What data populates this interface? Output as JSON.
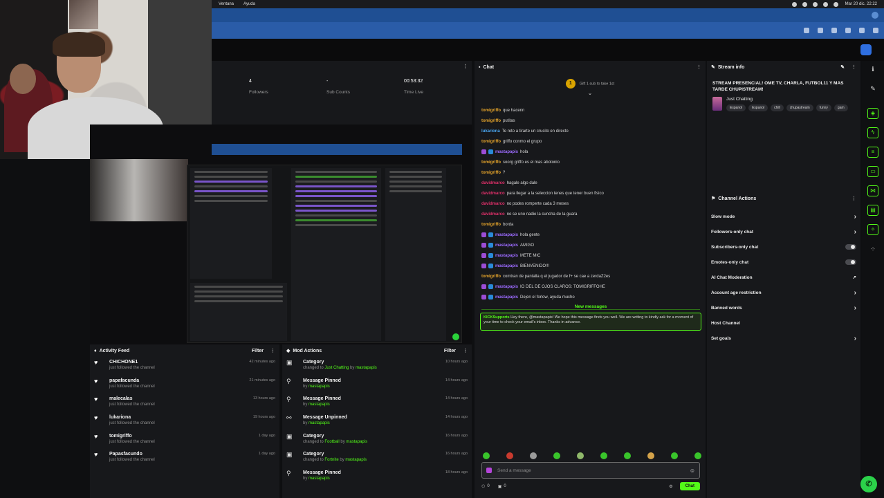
{
  "os_menu": {
    "items": [
      "Ventana",
      "Ayuda"
    ],
    "clock": "Mar 20 dic. 22:22"
  },
  "stats": [
    {
      "value": "4",
      "label": "Followers"
    },
    {
      "value": "-",
      "label": "Sub Counts"
    },
    {
      "value": "00:53:32",
      "label": "Time Live"
    }
  ],
  "activity": {
    "title": "Activity Feed",
    "filter": "Filter",
    "items": [
      {
        "name": "CHICHONE1",
        "sub": "just followed the channel",
        "time": "42 minutes ago"
      },
      {
        "name": "papafacunda",
        "sub": "just followed the channel",
        "time": "21 minutes ago"
      },
      {
        "name": "malecalas",
        "sub": "just followed the channel",
        "time": "13 hours ago"
      },
      {
        "name": "lukariona",
        "sub": "just followed the channel",
        "time": "19 hours ago"
      },
      {
        "name": "tomigriffo",
        "sub": "just followed the channel",
        "time": "1 day ago"
      },
      {
        "name": "Papasfacundo",
        "sub": "just followed the channel",
        "time": "1 day ago"
      }
    ]
  },
  "mod_actions": {
    "title": "Mod Actions",
    "filter": "Filter",
    "items": [
      {
        "icon": "category",
        "name": "Category",
        "pre": "changed to ",
        "hl": "Just Chatting",
        "post": " by ",
        "by": "mastapapis",
        "time": "10 hours ago"
      },
      {
        "icon": "pin",
        "name": "Message Pinned",
        "pre": "by ",
        "hl": "",
        "post": "",
        "by": "mastapapis",
        "time": "14 hours ago"
      },
      {
        "icon": "pin",
        "name": "Message Pinned",
        "pre": "by ",
        "hl": "",
        "post": "",
        "by": "mastapapis",
        "time": "14 hours ago"
      },
      {
        "icon": "unpin",
        "name": "Message Unpinned",
        "pre": "by ",
        "hl": "",
        "post": "",
        "by": "mastapapis",
        "time": "14 hours ago"
      },
      {
        "icon": "category",
        "name": "Category",
        "pre": "changed to ",
        "hl": "Football",
        "post": " by ",
        "by": "mastapapis",
        "time": "16 hours ago"
      },
      {
        "icon": "category",
        "name": "Category",
        "pre": "changed to ",
        "hl": "Fortnite",
        "post": " by ",
        "by": "mastapapis",
        "time": "16 hours ago"
      },
      {
        "icon": "pin",
        "name": "Message Pinned",
        "pre": "by ",
        "hl": "",
        "post": "",
        "by": "mastapapis",
        "time": "18 hours ago"
      }
    ]
  },
  "chat": {
    "title": "Chat",
    "pinned_text": "Gift 1 sub to take 1st",
    "new_messages": "New messages",
    "messages": [
      {
        "user": "tomigriffo",
        "color": "#e8a62b",
        "badge": false,
        "text": "que hacenn"
      },
      {
        "user": "tomigriffo",
        "color": "#e8a62b",
        "badge": false,
        "text": "putitas"
      },
      {
        "user": "lukariona",
        "color": "#4aa6f0",
        "badge": false,
        "text": "Te reto a tirarte un crucito en directo"
      },
      {
        "user": "tomigriffo",
        "color": "#e8a62b",
        "badge": false,
        "text": "griffo conmo el grupo"
      },
      {
        "user": "mastapapis",
        "color": "#9c6bff",
        "badge": true,
        "text": "hola"
      },
      {
        "user": "tomigriffo",
        "color": "#e8a62b",
        "badge": false,
        "text": "soorg griffo es el mas abotonio"
      },
      {
        "user": "tomigriffo",
        "color": "#e8a62b",
        "badge": false,
        "text": "?"
      },
      {
        "user": "davidmarco",
        "color": "#e0306a",
        "badge": false,
        "text": "hagale algo dale"
      },
      {
        "user": "davidmarco",
        "color": "#e0306a",
        "badge": false,
        "text": "para llegar a la seleccion tenes que tener buen fisico"
      },
      {
        "user": "davidmarco",
        "color": "#e0306a",
        "badge": false,
        "text": "no podes romperte cada 3 meses"
      },
      {
        "user": "davidmarco",
        "color": "#e0306a",
        "badge": false,
        "text": "no se uno nadie la cuncha de la guara"
      },
      {
        "user": "tomigriffo",
        "color": "#e8a62b",
        "badge": false,
        "text": "borda"
      },
      {
        "user": "mastapapis",
        "color": "#9c6bff",
        "badge": true,
        "text": "hola gente"
      },
      {
        "user": "mastapapis",
        "color": "#9c6bff",
        "badge": true,
        "text": "AMIGO"
      },
      {
        "user": "mastapapis",
        "color": "#9c6bff",
        "badge": true,
        "text": "METE MIC"
      },
      {
        "user": "mastapapis",
        "color": "#9c6bff",
        "badge": true,
        "text": "BIENVENIDO!!!"
      },
      {
        "user": "tomigriffo",
        "color": "#e8a62b",
        "badge": false,
        "text": "comtran de pantalla q el jugador de f+ se cae a zerdaZ2es"
      },
      {
        "user": "mastapapis",
        "color": "#9c6bff",
        "badge": true,
        "text": "IO DEL DE OJOS CLAROS: TOMIGRIFFOHE"
      },
      {
        "user": "mastapapis",
        "color": "#9c6bff",
        "badge": true,
        "text": "Dejen el forlow, ayuda mucho"
      }
    ],
    "bot_user": "KICKSupports",
    "bot_text": "Hey there, @mastapapis! We hope this message finds you well. We are writing to kindly ask for a moment of your time to check your email's inbox. Thanks in advance.",
    "input_placeholder": "Send a message",
    "chat_button": "Chat",
    "count_viewers": "0",
    "count_extra": "0"
  },
  "stream_info": {
    "title": "Stream info",
    "stream_title": "STREAM PRESENCIAL! OME TV, CHARLA, FUTBOL11 Y MAS TARDE CHUPISTREAM!",
    "category": "Just Chatting",
    "tags": [
      "Espanol",
      "Espanol",
      "chill",
      "chupastream",
      "funny",
      "gam"
    ]
  },
  "channel_actions": {
    "title": "Channel Actions",
    "items": [
      {
        "label": "Slow mode",
        "control": "arrow"
      },
      {
        "label": "Followers-only chat",
        "control": "arrow"
      },
      {
        "label": "Subscribers-only chat",
        "control": "toggle"
      },
      {
        "label": "Emotes-only chat",
        "control": "toggle"
      },
      {
        "label": "AI Chat Moderation",
        "control": "external"
      },
      {
        "label": "Account age restriction",
        "control": "arrow"
      },
      {
        "label": "Banned words",
        "control": "arrow"
      },
      {
        "label": "Host Channel",
        "control": "none"
      },
      {
        "label": "Set goals",
        "control": "arrow"
      }
    ]
  },
  "colors": {
    "accent": "#53fc18",
    "panel": "#17181b",
    "browser_tab": "#1f4f93",
    "browser_url": "#2a5ca8"
  }
}
